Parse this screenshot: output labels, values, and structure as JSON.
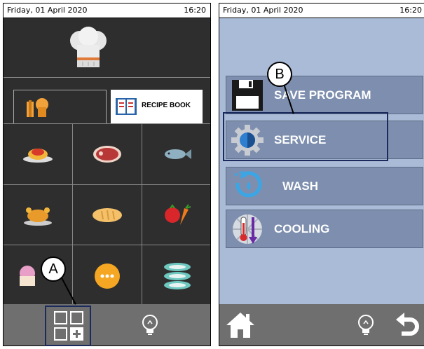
{
  "left_screen": {
    "status": {
      "date": "Friday, 01 April 2020",
      "time": "16:20"
    },
    "chef_icon": "chef-hat-icon",
    "tabs": [
      {
        "icon": "chef-books-icon",
        "label": ""
      },
      {
        "icon": "recipe-book-icon",
        "label": "RECIPE BOOK"
      }
    ],
    "categories": [
      {
        "icon": "pasta-icon"
      },
      {
        "icon": "meat-icon"
      },
      {
        "icon": "fish-icon"
      },
      {
        "icon": "poultry-icon"
      },
      {
        "icon": "bread-icon"
      },
      {
        "icon": "vegetables-icon"
      },
      {
        "icon": "dessert-icon"
      },
      {
        "icon": "more-icon"
      },
      {
        "icon": "plates-icon"
      }
    ],
    "bottom": {
      "left_icon": "add-program-grid-icon",
      "right_icon": "light-bulb-icon"
    },
    "callout_a": "A"
  },
  "right_screen": {
    "status": {
      "date": "Friday, 01 April 2020",
      "time": "16:20"
    },
    "menu": [
      {
        "label": "SAVE PROGRAM",
        "icon": "floppy-disk-icon"
      },
      {
        "label": "SERVICE",
        "icon": "gear-icon"
      },
      {
        "label": "WASH",
        "icon": "wash-cycle-icon"
      },
      {
        "label": "COOLING",
        "icon": "cooling-thermometer-icon"
      }
    ],
    "bottom": {
      "home_icon": "home-icon",
      "bulb_icon": "light-bulb-icon",
      "back_icon": "back-arrow-icon"
    },
    "callout_b": "B"
  }
}
